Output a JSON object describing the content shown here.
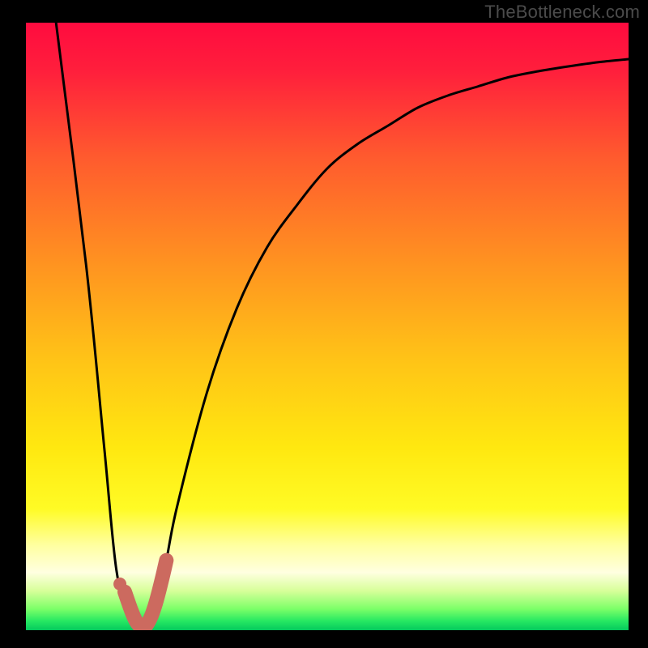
{
  "watermark": "TheBottleneck.com",
  "chart_data": {
    "type": "line",
    "title": "",
    "xlabel": "",
    "ylabel": "",
    "xlim": [
      0,
      100
    ],
    "ylim": [
      0,
      100
    ],
    "grid": false,
    "series": [
      {
        "name": "bottleneck-curve",
        "x": [
          5,
          10,
          13,
          15,
          17,
          19,
          21,
          23,
          25,
          30,
          35,
          40,
          45,
          50,
          55,
          60,
          65,
          70,
          75,
          80,
          85,
          90,
          95,
          100
        ],
        "y": [
          100,
          60,
          30,
          10,
          3,
          0,
          3,
          10,
          20,
          39,
          53,
          63,
          70,
          76,
          80,
          83,
          86,
          88,
          89.5,
          91,
          92,
          92.8,
          93.5,
          94
        ]
      }
    ],
    "marker": {
      "name": "highlight-segment",
      "points": [
        {
          "x": 16.4,
          "y": 6.3
        },
        {
          "x": 17.5,
          "y": 3.2
        },
        {
          "x": 18.2,
          "y": 1.6
        },
        {
          "x": 19.0,
          "y": 0.6
        },
        {
          "x": 19.8,
          "y": 0.6
        },
        {
          "x": 20.8,
          "y": 2.3
        },
        {
          "x": 21.7,
          "y": 5.0
        },
        {
          "x": 22.6,
          "y": 8.5
        },
        {
          "x": 23.3,
          "y": 11.5
        }
      ],
      "dot": {
        "x": 15.6,
        "y": 7.6
      }
    },
    "gradient_stops": [
      {
        "offset": 0.0,
        "color": "#ff0b3f"
      },
      {
        "offset": 0.08,
        "color": "#ff1f3c"
      },
      {
        "offset": 0.22,
        "color": "#ff5a2e"
      },
      {
        "offset": 0.4,
        "color": "#ff9420"
      },
      {
        "offset": 0.55,
        "color": "#ffc217"
      },
      {
        "offset": 0.7,
        "color": "#ffe810"
      },
      {
        "offset": 0.8,
        "color": "#fffb25"
      },
      {
        "offset": 0.86,
        "color": "#ffffa0"
      },
      {
        "offset": 0.905,
        "color": "#ffffe0"
      },
      {
        "offset": 0.935,
        "color": "#d8ff9a"
      },
      {
        "offset": 0.965,
        "color": "#7cff68"
      },
      {
        "offset": 0.985,
        "color": "#26e862"
      },
      {
        "offset": 1.0,
        "color": "#04c95d"
      }
    ],
    "highlight_color": "#cc6a5f",
    "curve_color": "#000000"
  }
}
